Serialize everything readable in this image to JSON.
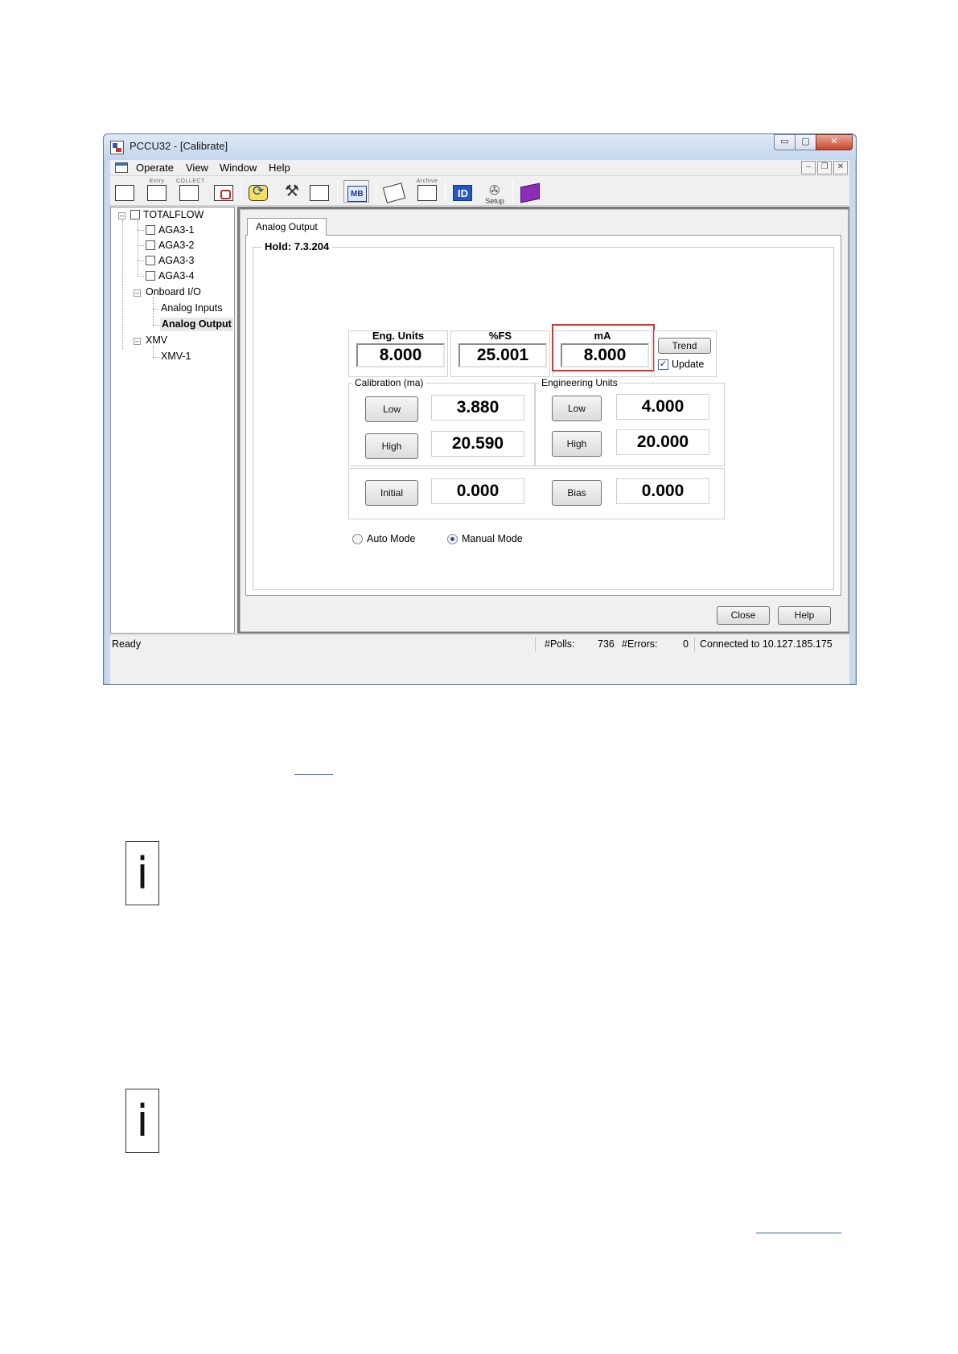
{
  "window": {
    "title": "PCCU32 - [Calibrate]",
    "min": "▭",
    "max": "▢",
    "close": "✕"
  },
  "menu": {
    "items": [
      "Operate",
      "View",
      "Window",
      "Help"
    ],
    "mdi_min": "–",
    "mdi_restore": "❐",
    "mdi_close": "✕"
  },
  "toolbar": {
    "entry_caption": "Entry",
    "collect_caption": "COLLECT",
    "archive_caption": "Archive",
    "setup_label": "Setup"
  },
  "tree": {
    "root": "TOTALFLOW",
    "items": [
      "AGA3-1",
      "AGA3-2",
      "AGA3-3",
      "AGA3-4"
    ],
    "onboard": "Onboard I/O",
    "onboard_children": [
      "Analog Inputs",
      "Analog Output"
    ],
    "xmv": "XMV",
    "xmv_children": [
      "XMV-1"
    ]
  },
  "tab": {
    "label": "Analog Output"
  },
  "hold": {
    "label": "Hold: 7.3.204"
  },
  "readings": {
    "eng_units_label": "Eng. Units",
    "eng_units_value": "8.000",
    "fs_label": "%FS",
    "fs_value": "25.001",
    "ma_label": "mA",
    "ma_value": "8.000"
  },
  "trend_button": "Trend",
  "update": {
    "label": "Update",
    "checked": true,
    "mark": "✓"
  },
  "calibration": {
    "label": "Calibration (ma)",
    "low_button": "Low",
    "low_value": "3.880",
    "high_button": "High",
    "high_value": "20.590"
  },
  "engineering": {
    "label": "Engineering Units",
    "low_button": "Low",
    "low_value": "4.000",
    "high_button": "High",
    "high_value": "20.000"
  },
  "initial": {
    "button": "Initial",
    "value": "0.000"
  },
  "bias": {
    "button": "Bias",
    "value": "0.000"
  },
  "mode": {
    "auto_label": "Auto Mode",
    "manual_label": "Manual Mode",
    "selected": "Manual Mode"
  },
  "dialog_buttons": {
    "close": "Close",
    "help": "Help"
  },
  "status": {
    "ready": "Ready",
    "polls_label": "#Polls:",
    "polls_value": "736",
    "errors_label": "#Errors:",
    "errors_value": "0",
    "connection": "Connected to 10.127.185.175"
  },
  "notes": {
    "icon_glyph": "i"
  }
}
